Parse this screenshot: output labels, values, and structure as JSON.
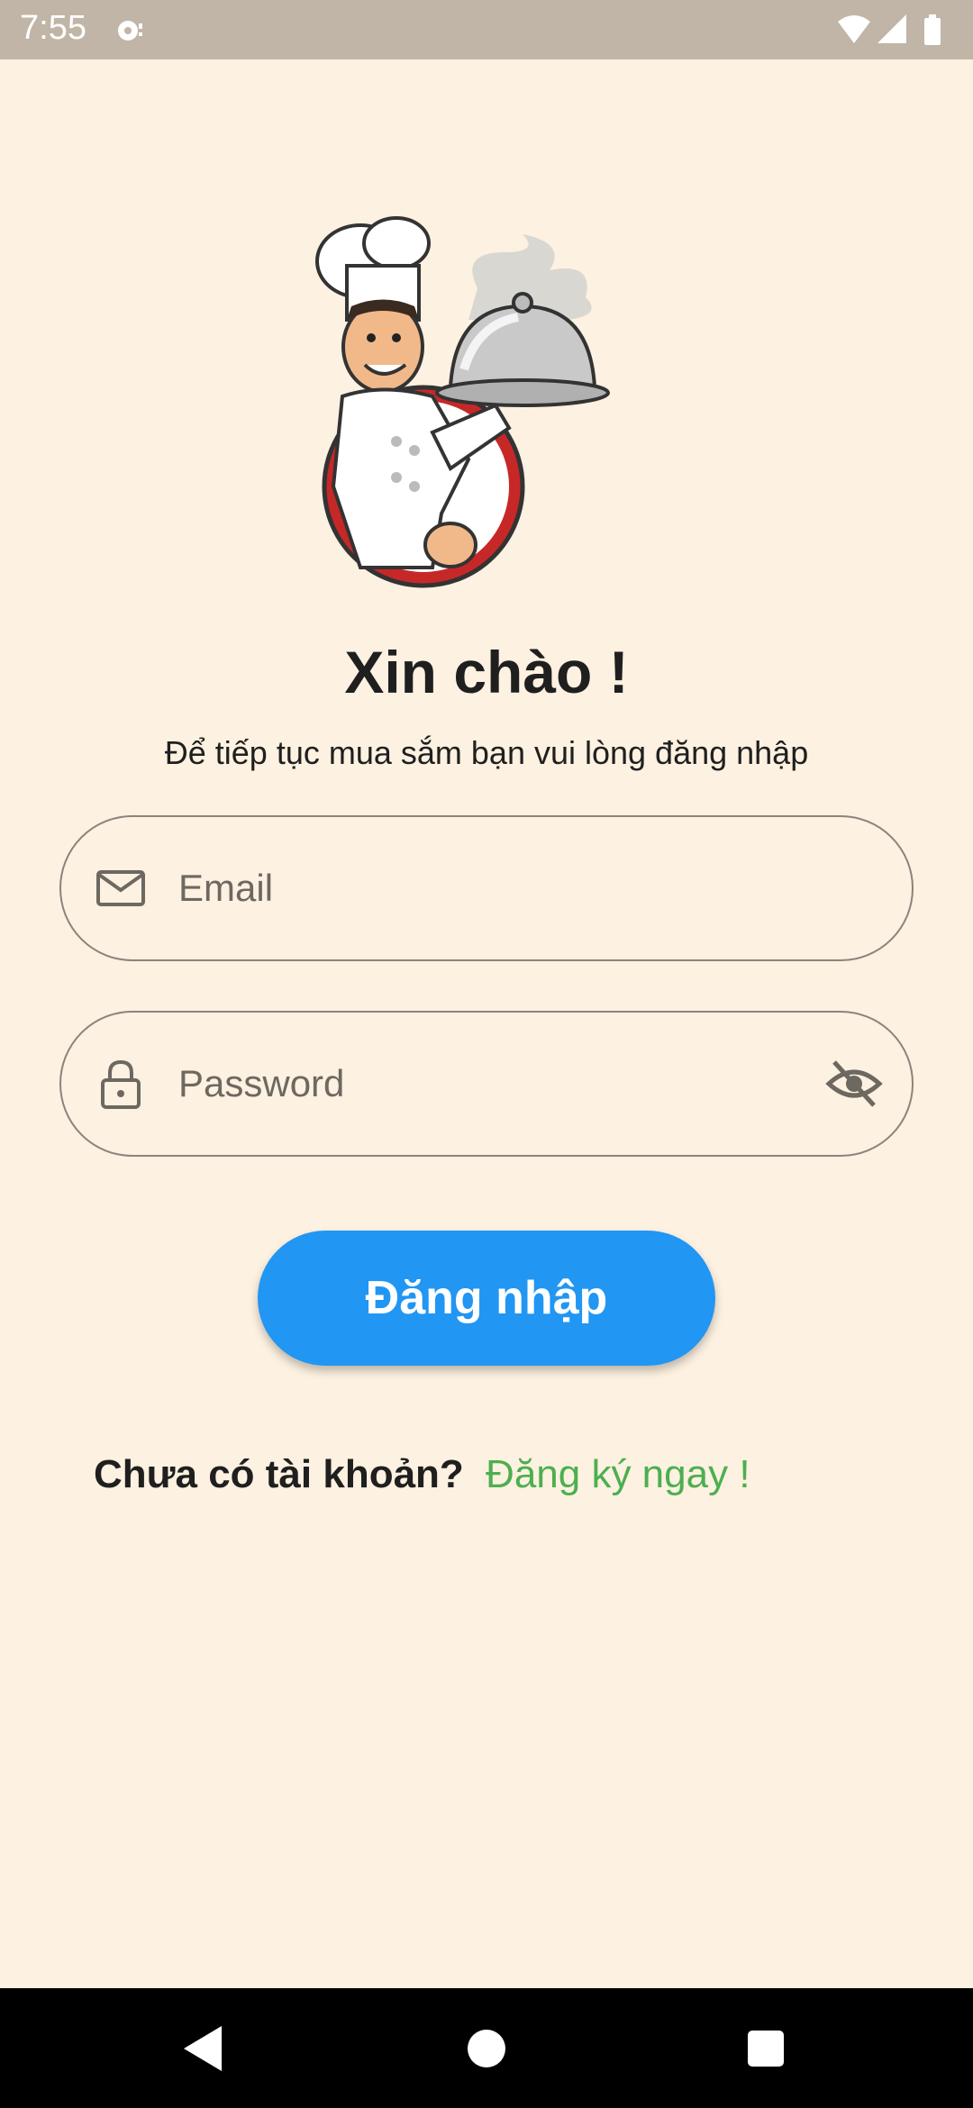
{
  "status_bar": {
    "time": "7:55",
    "icons": [
      "notification-icon",
      "wifi-icon",
      "signal-icon",
      "battery-icon"
    ]
  },
  "logo": {
    "icon": "chef-logo",
    "description_visible": false
  },
  "title": "Xin chào !",
  "subtitle": "Để tiếp tục mua sắm bạn vui lòng đăng nhập",
  "email_field": {
    "placeholder": "Email",
    "value": "",
    "icon": "mail-icon"
  },
  "password_field": {
    "placeholder": "Password",
    "value": "",
    "icon": "lock-icon",
    "toggle_icon": "eye-off-icon"
  },
  "login_button": {
    "label": "Đăng nhập"
  },
  "signup": {
    "question": "Chưa có tài khoản?",
    "link": "Đăng ký ngay !"
  },
  "colors": {
    "background": "#fdf1e1",
    "primary": "#2196f3",
    "link": "#4caf50",
    "status_bar": "#c0b5a6"
  }
}
